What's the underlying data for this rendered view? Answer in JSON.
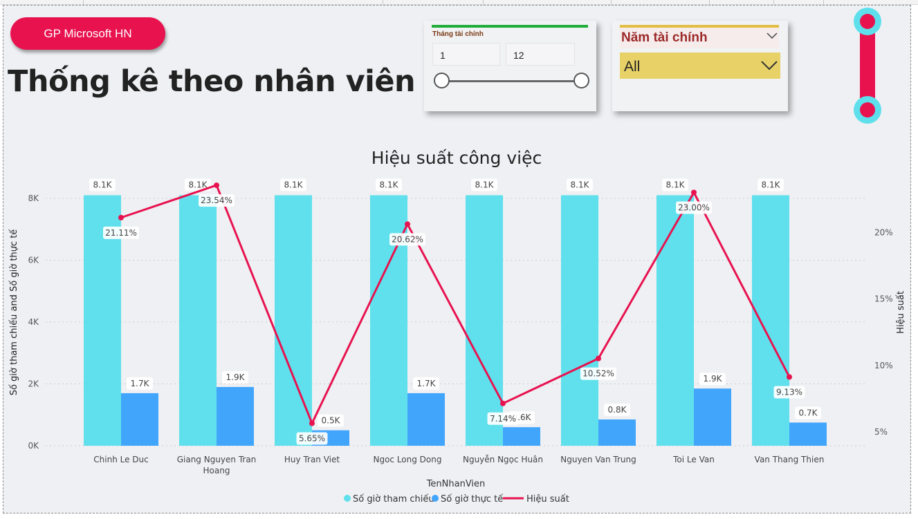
{
  "header": {
    "brand_button_label": "GP Microsoft HN",
    "page_title": "Thống kê theo nhân viên"
  },
  "slicer_month": {
    "title": "Tháng tài chính",
    "min_value": "1",
    "max_value": "12",
    "accent_color": "#1fad3a"
  },
  "slicer_year": {
    "title": "Năm tài chính",
    "selected_value": "All",
    "accent_color": "#e3be43"
  },
  "chart_data": {
    "type": "bar",
    "title": "Hiệu suất công việc",
    "xlabel": "TenNhanVien",
    "ylabel": "Số giờ tham chiếu and Số giờ thực tế",
    "y2label": "Hiệu suất",
    "ylim": [
      0,
      8300
    ],
    "y2lim": [
      3.5,
      25.0
    ],
    "y_ticks": [
      "0K",
      "2K",
      "4K",
      "6K",
      "8K"
    ],
    "y2_ticks": [
      "5%",
      "10%",
      "15%",
      "20%"
    ],
    "categories": [
      [
        "Chinh Le Duc"
      ],
      [
        "Giang Nguyen Tran",
        "Hoang"
      ],
      [
        "Huy Tran Viet"
      ],
      [
        "Ngoc Long Dong"
      ],
      [
        "Nguyễn Ngọc Huân"
      ],
      [
        "Nguyen Van Trung"
      ],
      [
        "Toi Le Van"
      ],
      [
        "Van Thang Thien"
      ]
    ],
    "series": [
      {
        "name": "Số giờ tham chiếu",
        "kind": "bar",
        "color": "#5fe0ec",
        "values": [
          8100,
          8100,
          8100,
          8100,
          8100,
          8100,
          8100,
          8100
        ],
        "labels": [
          "8.1K",
          "8.1K",
          "8.1K",
          "8.1K",
          "8.1K",
          "8.1K",
          "8.1K",
          "8.1K"
        ]
      },
      {
        "name": "Số giờ thực tế",
        "kind": "bar",
        "color": "#42a5fc",
        "values": [
          1700,
          1900,
          500,
          1700,
          600,
          850,
          1850,
          750
        ],
        "labels": [
          "1.7K",
          "1.9K",
          "0.5K",
          "1.7K",
          "0.6K",
          "0.8K",
          "1.9K",
          "0.7K"
        ]
      },
      {
        "name": "Hiệu suất",
        "kind": "line",
        "axis": "right",
        "color": "#e8124f",
        "values": [
          21.11,
          23.54,
          5.65,
          20.62,
          7.14,
          10.52,
          23.0,
          9.13
        ],
        "labels": [
          "21.11%",
          "23.54%",
          "5.65%",
          "20.62%",
          "7.14%",
          "10.52%",
          "23.00%",
          "9.13%"
        ]
      }
    ],
    "legend_position": "bottom-center",
    "grid": true
  }
}
